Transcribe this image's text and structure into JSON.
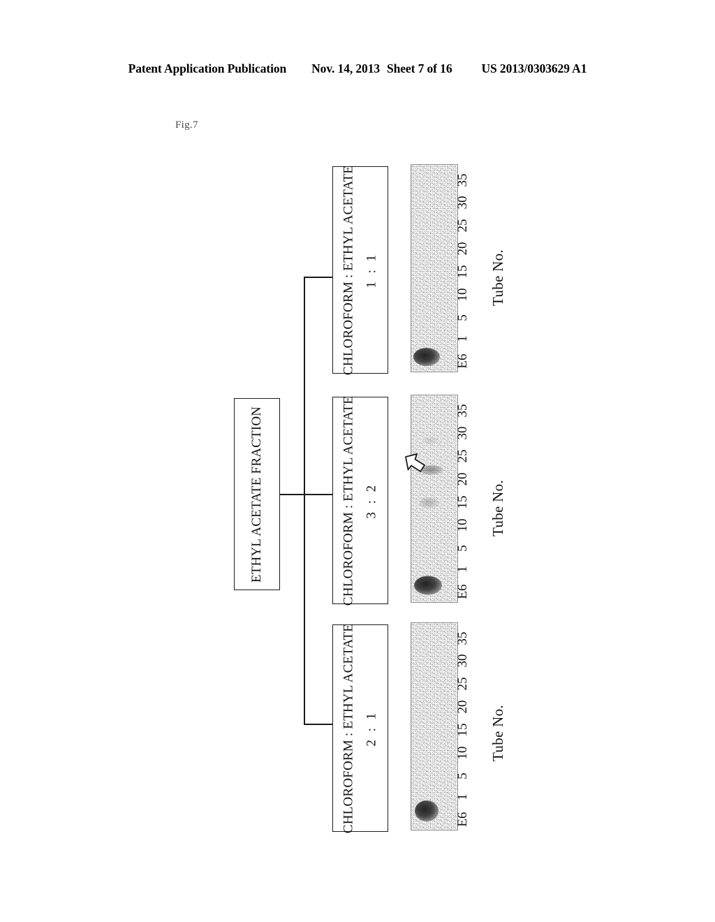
{
  "header": {
    "publication": "Patent Application Publication",
    "date": "Nov. 14, 2013",
    "sheet": "Sheet 7 of 16",
    "patent_number": "US 2013/0303629 A1"
  },
  "figure": {
    "label": "Fig.7"
  },
  "diagram": {
    "root": {
      "label": "ETHYL ACETATE FRACTION"
    },
    "branches": [
      {
        "id": "branch-1-1",
        "solvent_label": "CHLOROFORM : ETHYL ACETATE",
        "ratio": "1 : 1",
        "plate": {
          "axis_title": "Tube No.",
          "ticks": [
            "E6",
            "1",
            "5",
            "10",
            "15",
            "20",
            "25",
            "30",
            "35"
          ],
          "arrow_marker": false
        }
      },
      {
        "id": "branch-3-2",
        "solvent_label": "CHLOROFORM : ETHYL ACETATE",
        "ratio": "3 : 2",
        "plate": {
          "axis_title": "Tube No.",
          "ticks": [
            "E6",
            "1",
            "5",
            "10",
            "15",
            "20",
            "25",
            "30",
            "35"
          ],
          "arrow_marker": true
        }
      },
      {
        "id": "branch-2-1",
        "solvent_label": "CHLOROFORM : ETHYL ACETATE",
        "ratio": "2 : 1",
        "plate": {
          "axis_title": "Tube No.",
          "ticks": [
            "E6",
            "1",
            "5",
            "10",
            "15",
            "20",
            "25",
            "30",
            "35"
          ],
          "arrow_marker": false
        }
      }
    ]
  },
  "colors": {
    "ink": "#1a1a1a",
    "plate_background": "#f3f3f3",
    "plate_border": "#8f8f8f",
    "fig_label": "#4a4a4a"
  }
}
